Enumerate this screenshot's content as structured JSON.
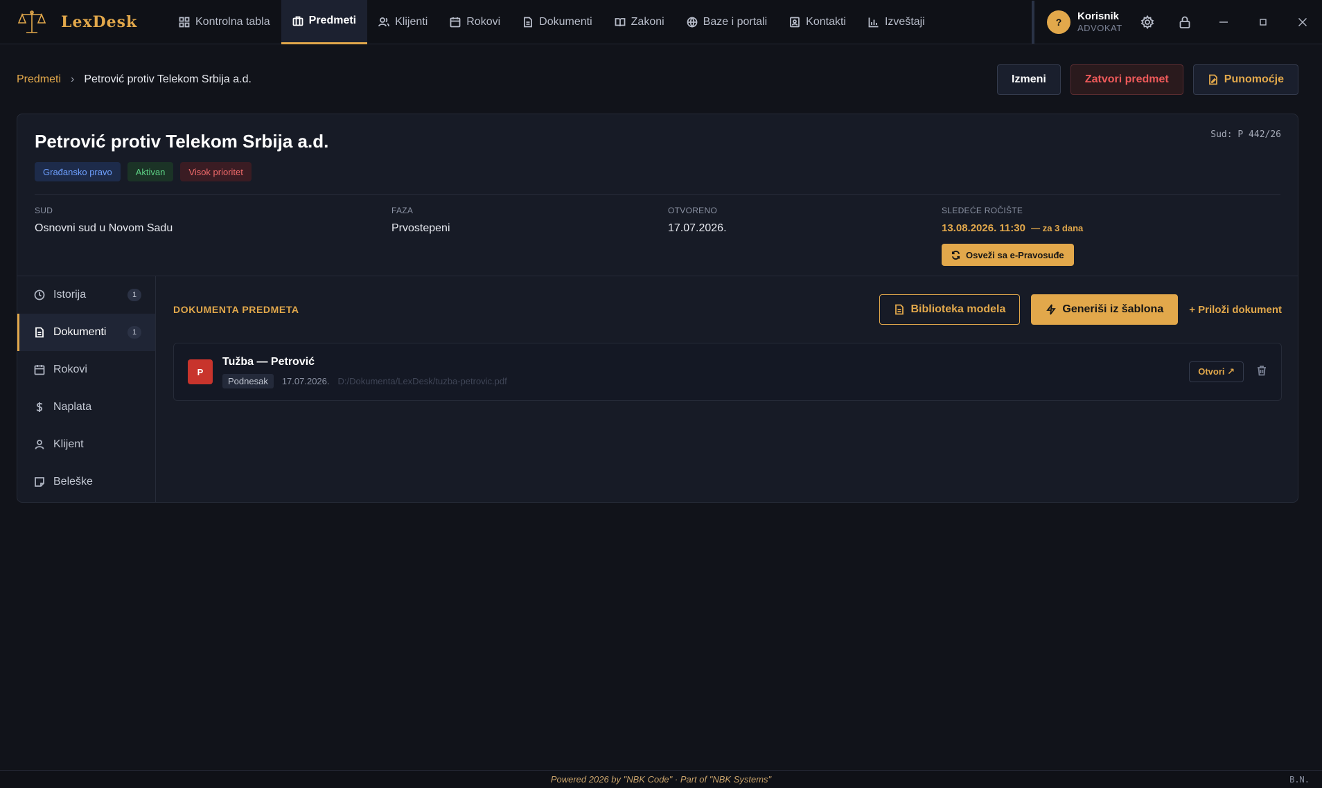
{
  "app": {
    "brand": "LexDesk"
  },
  "nav": {
    "items": [
      {
        "label": "Kontrolna tabla",
        "icon": "grid-icon"
      },
      {
        "label": "Predmeti",
        "icon": "briefcase-icon",
        "active": true
      },
      {
        "label": "Klijenti",
        "icon": "users-icon"
      },
      {
        "label": "Rokovi",
        "icon": "calendar-icon"
      },
      {
        "label": "Dokumenti",
        "icon": "document-icon"
      },
      {
        "label": "Zakoni",
        "icon": "book-icon"
      },
      {
        "label": "Baze i portali",
        "icon": "globe-icon"
      },
      {
        "label": "Kontakti",
        "icon": "contact-icon"
      },
      {
        "label": "Izveštaji",
        "icon": "chart-icon"
      }
    ]
  },
  "user": {
    "initial": "?",
    "name": "Korisnik",
    "role": "ADVOKAT"
  },
  "breadcrumb": {
    "root": "Predmeti",
    "current": "Petrović protiv Telekom Srbija a.d."
  },
  "actions": {
    "edit": "Izmeni",
    "close": "Zatvori predmet",
    "power": "Punomoćje"
  },
  "case": {
    "title": "Petrović protiv Telekom Srbija a.d.",
    "code": "Sud: P 442/26",
    "tags": [
      "Građansko pravo",
      "Aktivan",
      "Visok prioritet"
    ],
    "meta": {
      "court_label": "SUD",
      "court": "Osnovni sud u Novom Sadu",
      "phase_label": "FAZA",
      "phase": "Prvostepeni",
      "opened_label": "OTVORENO",
      "opened": "17.07.2026.",
      "hearing_label": "SLEDEĆE ROČIŠTE",
      "hearing_date": "13.08.2026.",
      "hearing_time": "11:30",
      "hearing_rel": "— za 3 dana",
      "sync": "Osveži sa e-Pravosuđe"
    }
  },
  "tabs": [
    {
      "label": "Istorija",
      "count": "1"
    },
    {
      "label": "Dokumenti",
      "count": "1",
      "active": true
    },
    {
      "label": "Rokovi"
    },
    {
      "label": "Naplata"
    },
    {
      "label": "Klijent"
    },
    {
      "label": "Beleške"
    }
  ],
  "docs": {
    "section_title": "DOKUMENTA PREDMETA",
    "library": "Biblioteka modela",
    "generate": "Generiši iz šablona",
    "attach": "+ Priloži dokument",
    "items": [
      {
        "badge": "P",
        "title": "Tužba — Petrović",
        "type": "Podnesak",
        "date": "17.07.2026.",
        "path": "D:/Dokumenta/LexDesk/tuzba-petrovic.pdf",
        "open": "Otvori ↗"
      }
    ]
  },
  "footer": {
    "text": "Powered 2026 by \"NBK Code\" · Part of \"NBK Systems\"",
    "right": "B.N."
  },
  "colors": {
    "accent": "#e2a84b",
    "bg": "#11131a",
    "card": "#171b26",
    "danger": "#ef5a5a"
  }
}
